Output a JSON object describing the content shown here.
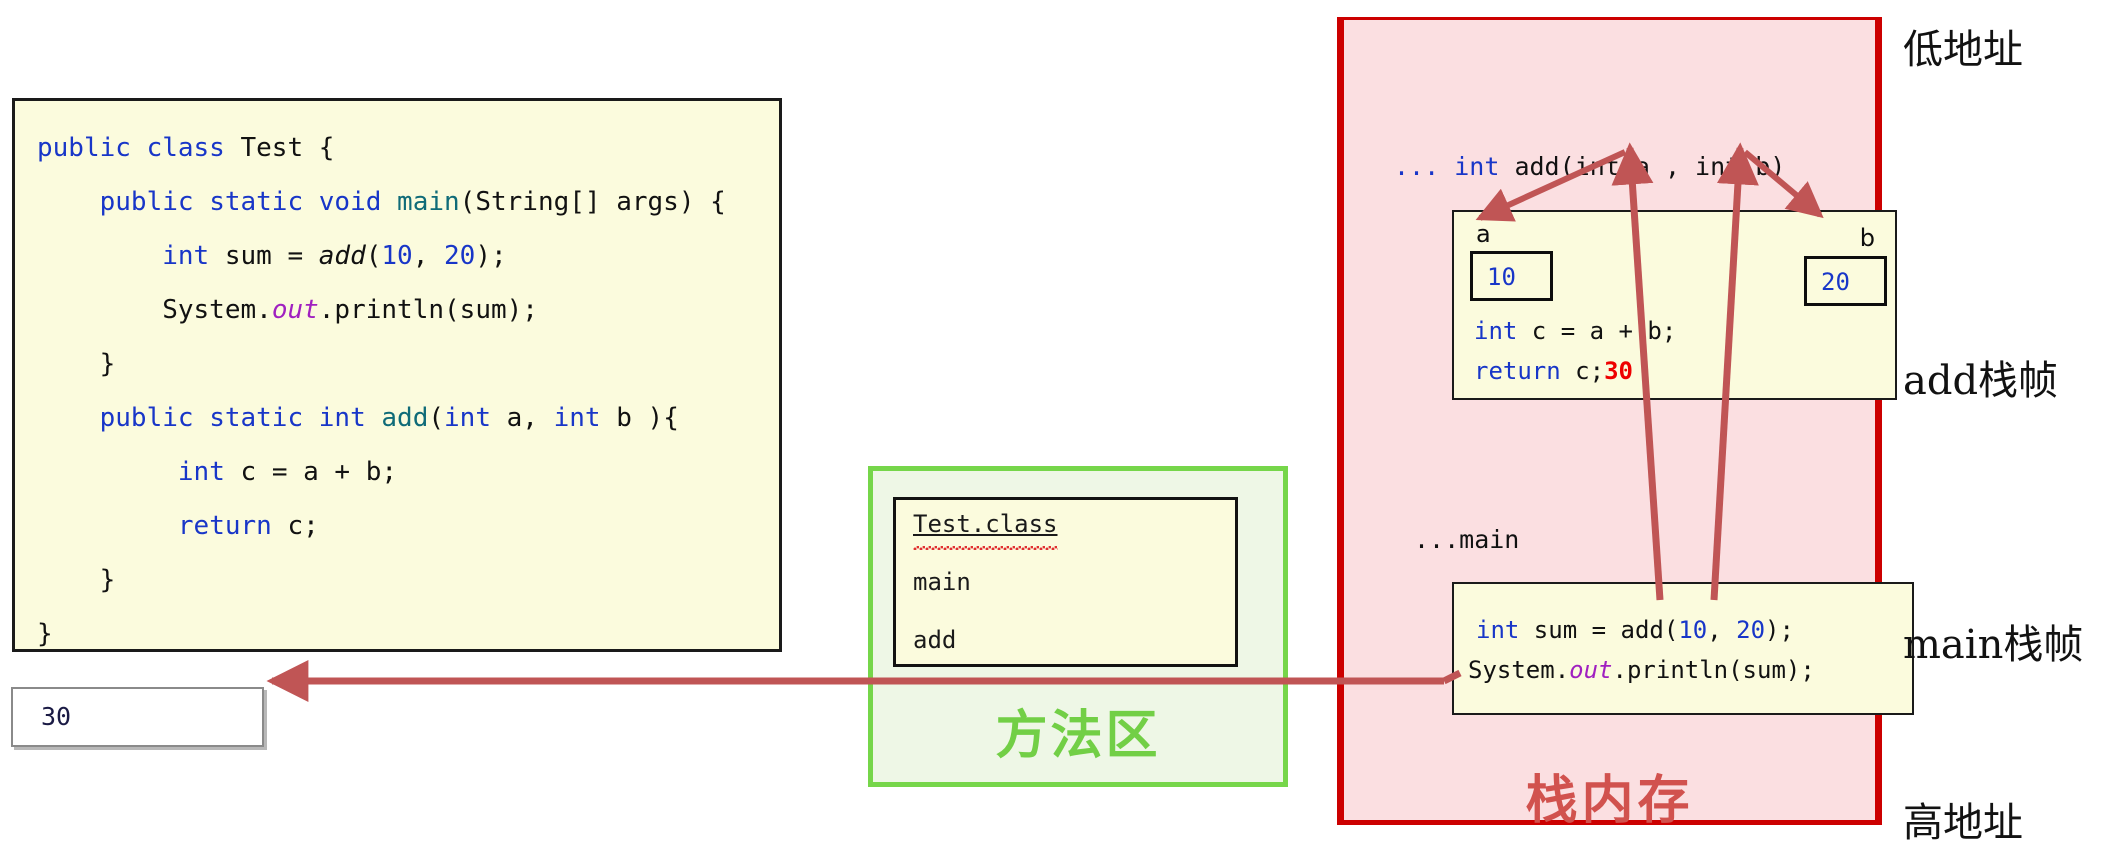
{
  "code_panel": {
    "lines": [
      [
        {
          "t": "public class ",
          "c": "kw"
        },
        {
          "t": "Test {",
          "c": ""
        }
      ],
      [
        {
          "t": "    ",
          "c": ""
        },
        {
          "t": "public static void ",
          "c": "kw"
        },
        {
          "t": "main",
          "c": "mth"
        },
        {
          "t": "(String[] args) {",
          "c": ""
        }
      ],
      [
        {
          "t": "        ",
          "c": ""
        },
        {
          "t": "int",
          "c": "kw"
        },
        {
          "t": " sum = ",
          "c": ""
        },
        {
          "t": "add",
          "c": "mthi"
        },
        {
          "t": "(",
          "c": ""
        },
        {
          "t": "10",
          "c": "num"
        },
        {
          "t": ", ",
          "c": ""
        },
        {
          "t": "20",
          "c": "num"
        },
        {
          "t": ");",
          "c": ""
        }
      ],
      [
        {
          "t": "        System.",
          "c": ""
        },
        {
          "t": "out",
          "c": "fld"
        },
        {
          "t": ".println(sum);",
          "c": ""
        }
      ],
      [
        {
          "t": "    }",
          "c": ""
        }
      ],
      [
        {
          "t": "    ",
          "c": ""
        },
        {
          "t": "public static int ",
          "c": "kw"
        },
        {
          "t": "add",
          "c": "mth"
        },
        {
          "t": "(",
          "c": ""
        },
        {
          "t": "int",
          "c": "kw"
        },
        {
          "t": " a, ",
          "c": ""
        },
        {
          "t": "int",
          "c": "kw"
        },
        {
          "t": " b ){",
          "c": ""
        }
      ],
      [
        {
          "t": "         ",
          "c": ""
        },
        {
          "t": "int",
          "c": "kw"
        },
        {
          "t": " c = a + b;",
          "c": ""
        }
      ],
      [
        {
          "t": "         ",
          "c": ""
        },
        {
          "t": "return",
          "c": "kw"
        },
        {
          "t": " c;",
          "c": ""
        }
      ],
      [
        {
          "t": "    }",
          "c": ""
        }
      ],
      [
        {
          "t": "}",
          "c": ""
        }
      ]
    ]
  },
  "console": {
    "value": "30"
  },
  "method_area": {
    "label": "方法区",
    "class_box": {
      "entries": [
        "Test.class",
        "main",
        "add"
      ]
    },
    "border_color": "#76d64a",
    "fill_color": "#eef7e6"
  },
  "stack": {
    "label": "栈内存",
    "border_color": "#cc0000",
    "fill_color": "#fbdfe1",
    "add_frame": {
      "signature": "... int add(int a , int b)",
      "param_a_label": "a",
      "param_a_value": "10",
      "param_b_label": "b",
      "param_b_value": "20",
      "line_1": "int c = a + b;",
      "line_2": "return c;",
      "return_value": "30"
    },
    "main_frame": {
      "signature": "...main",
      "line_1": "int sum = add(10, 20);",
      "line_2": "System.out.println(sum);"
    }
  },
  "address_labels": {
    "low": "低地址",
    "add_frame": "add栈帧",
    "main_frame": "main栈帧",
    "high": "高地址"
  },
  "colors": {
    "arrow": "#c05555",
    "code_bg": "#fbfbdd",
    "keyword": "#1836c8",
    "method": "#0f6b78",
    "field": "#a020c0",
    "return_value": "#ee0000"
  }
}
